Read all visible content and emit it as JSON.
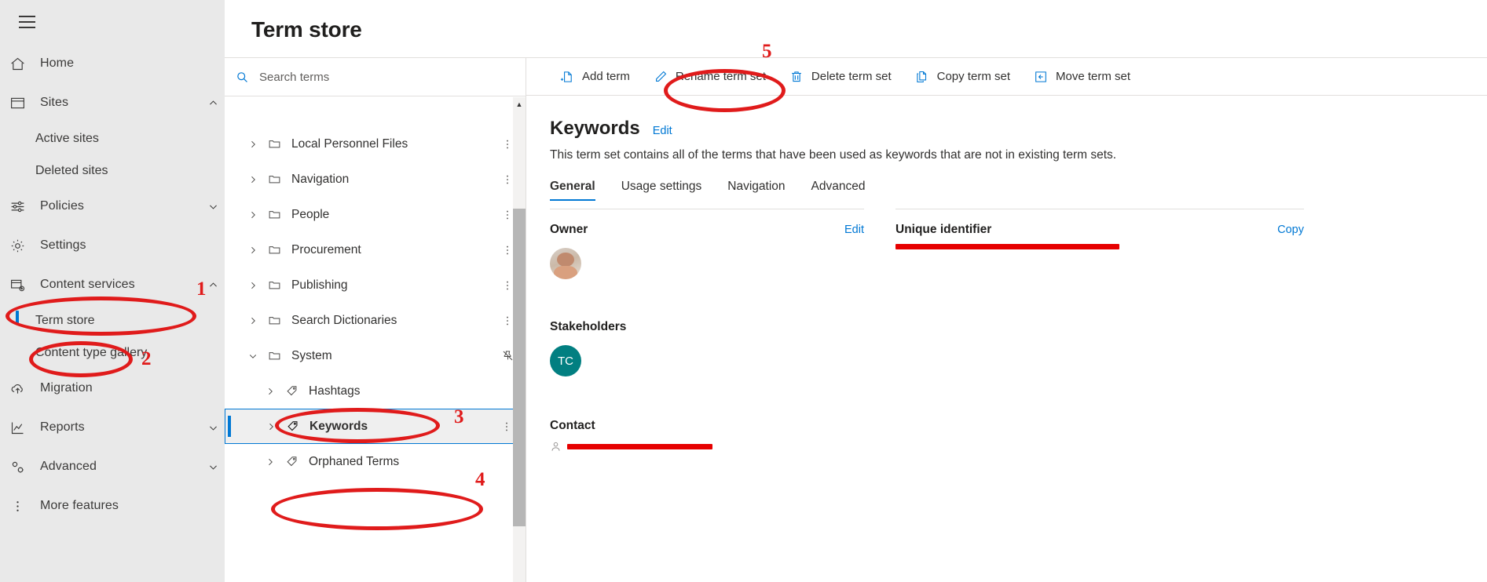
{
  "leftnav": {
    "hamburger_icon": "hamburger-menu-icon",
    "items": [
      {
        "label": "Home",
        "icon": "home-icon",
        "type": "item",
        "chevron": ""
      },
      {
        "label": "Sites",
        "icon": "sites-icon",
        "type": "item",
        "chevron": "up"
      },
      {
        "label": "Active sites",
        "icon": "",
        "type": "sub",
        "chevron": ""
      },
      {
        "label": "Deleted sites",
        "icon": "",
        "type": "sub",
        "chevron": ""
      },
      {
        "label": "Policies",
        "icon": "policies-icon",
        "type": "item",
        "chevron": "down"
      },
      {
        "label": "Settings",
        "icon": "gear-icon",
        "type": "item",
        "chevron": ""
      },
      {
        "label": "Content services",
        "icon": "content-services-icon",
        "type": "item",
        "chevron": "up"
      },
      {
        "label": "Term store",
        "icon": "",
        "type": "sub",
        "chevron": "",
        "selected": true
      },
      {
        "label": "Content type gallery",
        "icon": "",
        "type": "sub",
        "chevron": ""
      },
      {
        "label": "Migration",
        "icon": "migration-cloud-icon",
        "type": "item",
        "chevron": ""
      },
      {
        "label": "Reports",
        "icon": "reports-chart-icon",
        "type": "item",
        "chevron": "down"
      },
      {
        "label": "Advanced",
        "icon": "advanced-gear-icon",
        "type": "item",
        "chevron": "down"
      },
      {
        "label": "More features",
        "icon": "more-vertical-icon",
        "type": "item",
        "chevron": ""
      }
    ]
  },
  "header": {
    "title": "Term store"
  },
  "search": {
    "placeholder": "Search terms",
    "value": "",
    "icon": "search-icon"
  },
  "tree": {
    "nodes": [
      {
        "label": "Local Personnel Files",
        "icon": "folder-icon",
        "level": 1,
        "expanded": false,
        "more": true
      },
      {
        "label": "Navigation",
        "icon": "folder-icon",
        "level": 1,
        "expanded": false,
        "more": true
      },
      {
        "label": "People",
        "icon": "folder-icon",
        "level": 1,
        "expanded": false,
        "more": true
      },
      {
        "label": "Procurement",
        "icon": "folder-icon",
        "level": 1,
        "expanded": false,
        "more": true
      },
      {
        "label": "Publishing",
        "icon": "folder-icon",
        "level": 1,
        "expanded": false,
        "more": true
      },
      {
        "label": "Search Dictionaries",
        "icon": "folder-icon",
        "level": 1,
        "expanded": false,
        "more": true
      },
      {
        "label": "System",
        "icon": "folder-icon",
        "level": 1,
        "expanded": true,
        "more": false,
        "pin": true
      },
      {
        "label": "Hashtags",
        "icon": "tag-icon",
        "level": 2,
        "expanded": false,
        "more": false
      },
      {
        "label": "Keywords",
        "icon": "tag-icon",
        "level": 2,
        "expanded": false,
        "more": true,
        "selected": true
      },
      {
        "label": "Orphaned Terms",
        "icon": "tag-icon",
        "level": 2,
        "expanded": false,
        "more": false
      }
    ]
  },
  "commandbar": {
    "commands": [
      {
        "label": "Add term",
        "icon": "add-term-icon"
      },
      {
        "label": "Rename term set",
        "icon": "pencil-icon"
      },
      {
        "label": "Delete term set",
        "icon": "trash-icon"
      },
      {
        "label": "Copy term set",
        "icon": "copy-icon"
      },
      {
        "label": "Move term set",
        "icon": "move-icon"
      }
    ]
  },
  "details": {
    "title": "Keywords",
    "title_edit_label": "Edit",
    "description": "This term set contains all of the terms that have been used as keywords that are not in existing term sets.",
    "tabs": [
      {
        "label": "General",
        "active": true
      },
      {
        "label": "Usage settings",
        "active": false
      },
      {
        "label": "Navigation",
        "active": false
      },
      {
        "label": "Advanced",
        "active": false
      }
    ],
    "fields": {
      "owner": {
        "label": "Owner",
        "action": "Edit",
        "avatar": "owner-photo"
      },
      "unique_identifier": {
        "label": "Unique identifier",
        "action": "Copy",
        "value": "",
        "redacted": true
      },
      "stakeholders": {
        "label": "Stakeholders",
        "avatar_initials": "TC",
        "avatar_color": "#027f81"
      },
      "contact": {
        "label": "Contact",
        "value": "",
        "redacted": true,
        "icon": "person-icon"
      }
    }
  },
  "annotations": {
    "color": "#e01b1b",
    "markers": [
      {
        "number": "1",
        "target": "Content services"
      },
      {
        "number": "2",
        "target": "Term store"
      },
      {
        "number": "3",
        "target": "System"
      },
      {
        "number": "4",
        "target": "Keywords"
      },
      {
        "number": "5",
        "target": "Add term"
      }
    ]
  }
}
